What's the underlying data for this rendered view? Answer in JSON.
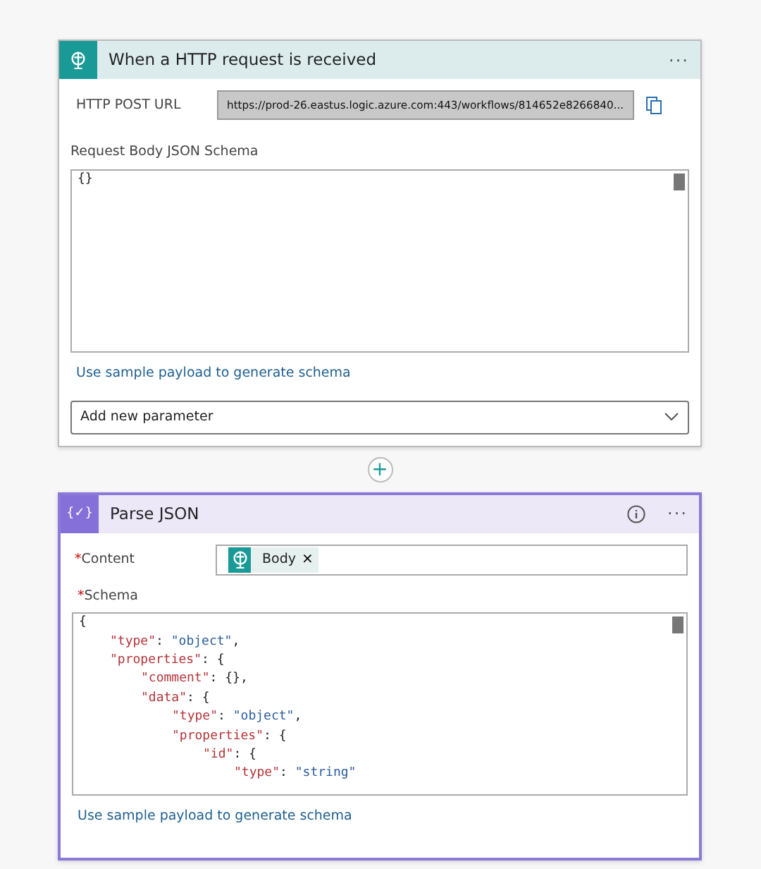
{
  "trigger": {
    "title": "When a HTTP request is received",
    "menu": "···",
    "url_label": "HTTP POST URL",
    "url": "https://prod-26.eastus.logic.azure.com:443/workflows/814652e8266840...",
    "schema_label": "Request Body JSON Schema",
    "schema_lines": [
      {
        "text": "{}"
      }
    ],
    "sample_link": "Use sample payload to generate schema",
    "parameter_dropdown": "Add new parameter"
  },
  "connector": {
    "add": "+"
  },
  "action": {
    "title": "Parse JSON",
    "icon_text": "{✓}",
    "menu": "···",
    "content_label": "Content",
    "required_mark": "*",
    "content_token": {
      "text": "Body",
      "remove": "×"
    },
    "schema_label": "Schema",
    "schema_lines": [
      {
        "text": "{",
        "children": [
          {
            "text": "\"type\": \"object\","
          },
          {
            "text": "\"properties\": {",
            "children": [
              {
                "text": "\"comment\": {},"
              },
              {
                "text": "\"data\": {",
                "children": [
                  {
                    "text": "\"type\": \"object\","
                  },
                  {
                    "text": "\"properties\": {",
                    "children": [
                      {
                        "text": "\"id\": {",
                        "children": [
                          {
                            "text": "\"type\": \"string\""
                          }
                        ]
                      }
                    ]
                  }
                ]
              }
            ]
          }
        ]
      }
    ],
    "sample_link": "Use sample payload to generate schema"
  }
}
